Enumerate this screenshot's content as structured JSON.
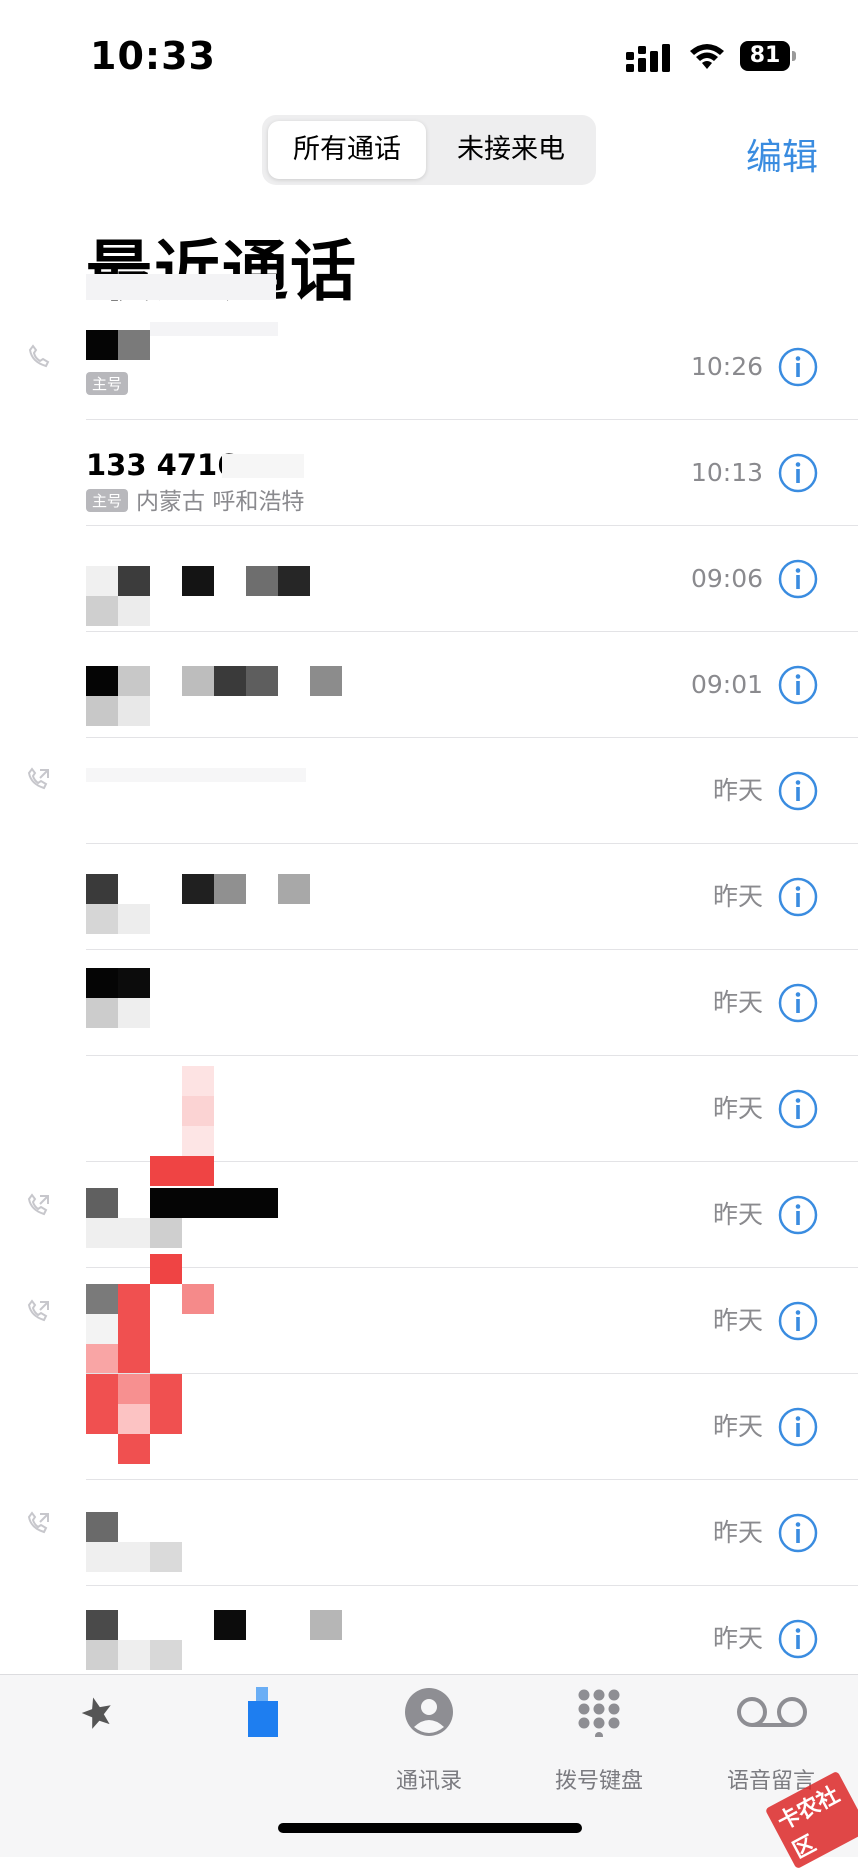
{
  "status_bar": {
    "time": "10:33",
    "battery": "81"
  },
  "header": {
    "segments": [
      "所有通话",
      "未接来电"
    ],
    "edit_label": "编辑",
    "title": "最近通话"
  },
  "calls": [
    {
      "time": "10:26",
      "outgoing": true,
      "number": "",
      "badge": "主号",
      "sub": ""
    },
    {
      "time": "10:13",
      "outgoing": false,
      "number": "133 4716",
      "badge": "主号",
      "sub": "内蒙古 呼和浩特"
    },
    {
      "time": "09:06",
      "outgoing": false,
      "number": "",
      "badge": "",
      "sub": ""
    },
    {
      "time": "09:01",
      "outgoing": false,
      "number": "",
      "badge": "",
      "sub": ""
    },
    {
      "time": "昨天",
      "outgoing": true,
      "number": "",
      "badge": "",
      "sub": ""
    },
    {
      "time": "昨天",
      "outgoing": false,
      "number": "",
      "badge": "",
      "sub": ""
    },
    {
      "time": "昨天",
      "outgoing": false,
      "number": "",
      "badge": "",
      "sub": ""
    },
    {
      "time": "昨天",
      "outgoing": false,
      "number": "",
      "badge": "",
      "sub": ""
    },
    {
      "time": "昨天",
      "outgoing": true,
      "number": "",
      "badge": "",
      "sub": ""
    },
    {
      "time": "昨天",
      "outgoing": true,
      "number": "",
      "badge": "",
      "sub": ""
    },
    {
      "time": "昨天",
      "outgoing": false,
      "number": "",
      "badge": "",
      "sub": ""
    },
    {
      "time": "昨天",
      "outgoing": true,
      "number": "",
      "badge": "",
      "sub": ""
    },
    {
      "time": "昨天",
      "outgoing": false,
      "number": "",
      "badge": "",
      "sub": ""
    }
  ],
  "tabs": [
    {
      "label": "",
      "icon": "star-icon"
    },
    {
      "label": "",
      "icon": "clock-icon"
    },
    {
      "label": "通讯录",
      "icon": "person-circle-icon"
    },
    {
      "label": "拨号键盘",
      "icon": "keypad-icon"
    },
    {
      "label": "语音留言",
      "icon": "voicemail-icon"
    }
  ],
  "watermark": "卡农社区",
  "colors": {
    "accent": "#3a8ce0",
    "secondary_text": "#8a8a8e",
    "redaction_red": "#f05050"
  }
}
